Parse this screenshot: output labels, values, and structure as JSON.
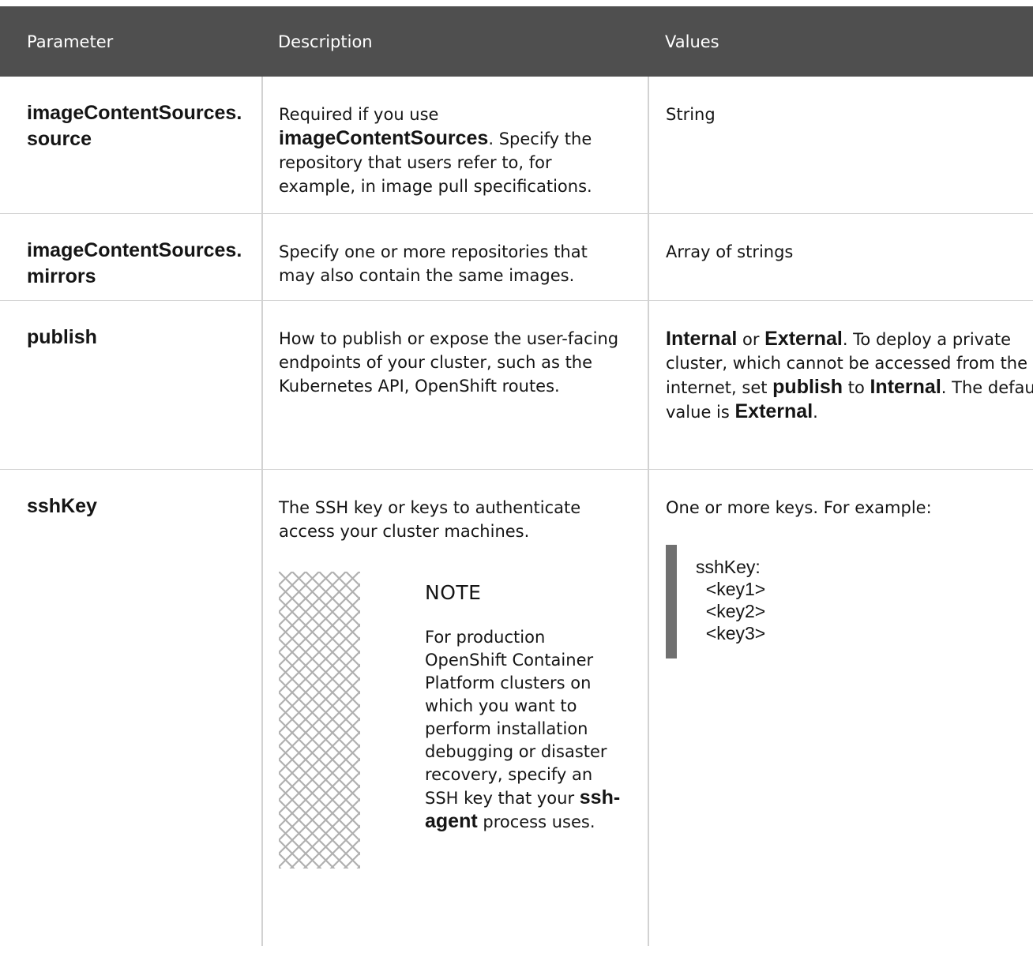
{
  "table": {
    "headers": {
      "parameter": "Parameter",
      "description": "Description",
      "values": "Values"
    },
    "rows": {
      "source": {
        "parameter": "imageContentSources.source",
        "description_prefix": "Required if you use ",
        "description_bold": "imageContentSources",
        "description_suffix": ". Specify the repository that users refer to, for example, in image pull specifications.",
        "values": "String"
      },
      "mirrors": {
        "parameter": "imageContentSources.mirrors",
        "description": "Specify one or more repositories that may also contain the same images.",
        "values": "Array of strings"
      },
      "publish": {
        "parameter": "publish",
        "description": "How to publish or expose the user-facing endpoints of your cluster, such as the Kubernetes API, OpenShift routes.",
        "values_internal": "Internal",
        "values_or": " or ",
        "values_external": "External",
        "values_text1": ". To deploy a private cluster, which cannot be accessed from the internet, set ",
        "values_publish": "publish",
        "values_to": " to ",
        "values_internal2": "Internal",
        "values_text2": ". The default value is ",
        "values_external2": "External",
        "values_end": "."
      },
      "sshkey": {
        "parameter": "sshKey",
        "description": "The SSH key or keys to authenticate access your cluster machines.",
        "note_title": "NOTE",
        "note_text_prefix": "For production OpenShift Container Platform clusters on which you want to perform installation debugging or disaster recovery, specify an SSH key that your ",
        "note_text_bold": "ssh-agent",
        "note_text_suffix": " process uses.",
        "values_intro": "One or more keys. For example:",
        "code": "sshKey:\n  <key1>\n  <key2>\n  <key3>"
      }
    }
  },
  "colors": {
    "header_bg": "#4f4f4f",
    "border": "#d2d2d2",
    "code_bar": "#707070"
  }
}
